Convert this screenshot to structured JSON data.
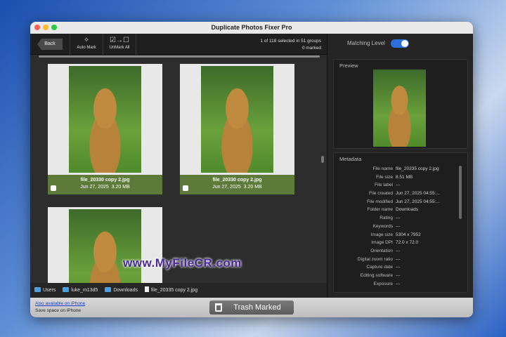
{
  "window": {
    "title": "Duplicate Photos Fixer Pro"
  },
  "toolbar": {
    "back": "Back",
    "auto_mark": "Auto Mark",
    "unmark_all": "UnMark All",
    "unmark_icon": "☑→☐",
    "status_line1": "1 of 118 selected in 51 groups",
    "status_line2": "0 marked"
  },
  "cards": [
    {
      "name": "file_20330 copy 2.jpg",
      "date": "Jun 27, 2025",
      "size": "3.20 MB"
    },
    {
      "name": "file_20330 copy 2.jpg",
      "date": "Jun 27, 2025",
      "size": "3.20 MB"
    }
  ],
  "breadcrumb": [
    "Users",
    "luke_m13d5",
    "Downloads",
    "file_20335 copy 2.jpg"
  ],
  "watermark": "www.MyFileCR.com",
  "right": {
    "matching_level": "Matching Level",
    "preview": "Preview",
    "metadata": "Metadata"
  },
  "metadata": [
    [
      "File name",
      "file_20335 copy 2.jpg"
    ],
    [
      "File size",
      "8.51 MB"
    ],
    [
      "File label",
      "---"
    ],
    [
      "File created",
      "Jun 27, 2025 04:55:..."
    ],
    [
      "File modified",
      "Jun 27, 2025 04:55:..."
    ],
    [
      "Folder name",
      "Downloads"
    ],
    [
      "Rating",
      "---"
    ],
    [
      "Keywords",
      "---"
    ],
    [
      "Image size",
      "5304 x 7952"
    ],
    [
      "Image DPI",
      "72.0 x 72.0"
    ],
    [
      "Orientation",
      "---"
    ],
    [
      "Digital zoom ratio",
      "---"
    ],
    [
      "Capture date",
      "---"
    ],
    [
      "Editing software",
      "---"
    ],
    [
      "Exposure",
      "---"
    ]
  ],
  "footer": {
    "link": "Also available on iPhone",
    "note": "Save space on iPhone",
    "trash": "Trash Marked"
  }
}
